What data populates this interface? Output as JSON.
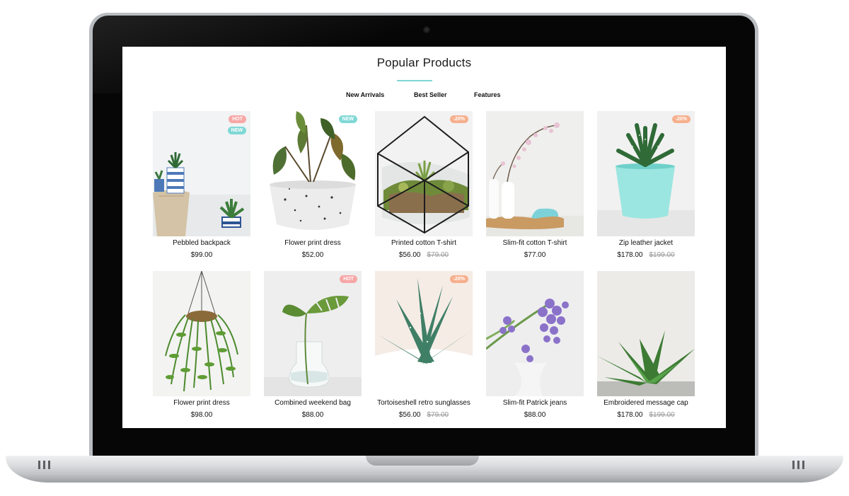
{
  "section": {
    "title": "Popular Products"
  },
  "tabs": [
    "New Arrivals",
    "Best Seller",
    "Features"
  ],
  "products": [
    {
      "name": "Pebbled backpack",
      "price": "$99.00",
      "old_price": "",
      "badges": [
        {
          "text": "HOT",
          "color": "#f7a6a6"
        },
        {
          "text": "NEW",
          "color": "#80d8d6"
        }
      ]
    },
    {
      "name": "Flower print dress",
      "price": "$52.00",
      "old_price": "",
      "badges": [
        {
          "text": "NEW",
          "color": "#80d8d6"
        }
      ]
    },
    {
      "name": "Printed cotton T-shirt",
      "price": "$56.00",
      "old_price": "$79.00",
      "badges": [
        {
          "text": "-20%",
          "color": "#f6b08e"
        }
      ]
    },
    {
      "name": "Slim-fit cotton T-shirt",
      "price": "$77.00",
      "old_price": "",
      "badges": []
    },
    {
      "name": "Zip leather jacket",
      "price": "$178.00",
      "old_price": "$199.00",
      "badges": [
        {
          "text": "-20%",
          "color": "#f6b08e"
        }
      ]
    },
    {
      "name": "Flower print dress",
      "price": "$98.00",
      "old_price": "",
      "badges": []
    },
    {
      "name": "Combined weekend bag",
      "price": "$88.00",
      "old_price": "",
      "badges": [
        {
          "text": "HOT",
          "color": "#f7a6a6"
        }
      ]
    },
    {
      "name": "Tortoiseshell retro sunglasses",
      "price": "$56.00",
      "old_price": "$79.00",
      "badges": [
        {
          "text": "-20%",
          "color": "#f6b08e"
        }
      ]
    },
    {
      "name": "Slim-fit Patrick jeans",
      "price": "$88.00",
      "old_price": "",
      "badges": []
    },
    {
      "name": "Embroidered message cap",
      "price": "$178.00",
      "old_price": "$199.00",
      "badges": []
    }
  ]
}
